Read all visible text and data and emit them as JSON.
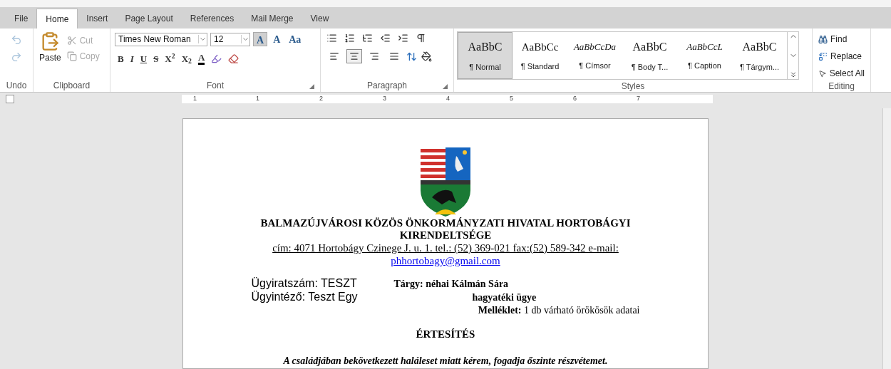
{
  "tabs": [
    {
      "label": "File",
      "selected": false
    },
    {
      "label": "Home",
      "selected": true
    },
    {
      "label": "Insert",
      "selected": false
    },
    {
      "label": "Page Layout",
      "selected": false
    },
    {
      "label": "References",
      "selected": false
    },
    {
      "label": "Mail Merge",
      "selected": false
    },
    {
      "label": "View",
      "selected": false
    }
  ],
  "undo": {
    "label": "Undo"
  },
  "clipboard": {
    "paste": "Paste",
    "cut": "Cut",
    "copy": "Copy",
    "label": "Clipboard"
  },
  "font": {
    "name": "Times New Roman",
    "size": "12",
    "label": "Font",
    "size_buttons": [
      {
        "label": "A",
        "selected": true
      },
      {
        "label": "A",
        "selected": false
      },
      {
        "label": "Aa",
        "selected": false
      }
    ],
    "format_buttons": [
      {
        "kind": "bold",
        "label": "B"
      },
      {
        "kind": "italic",
        "label": "I"
      },
      {
        "kind": "underline",
        "label": "U"
      },
      {
        "kind": "strike",
        "label": "S"
      },
      {
        "kind": "super",
        "label": "X$^{2}$"
      },
      {
        "kind": "sub",
        "label": "X$_{2}$"
      },
      {
        "kind": "color",
        "label": "A"
      }
    ]
  },
  "paragraph": {
    "label": "Paragraph",
    "align": [
      {
        "selected": false
      },
      {
        "selected": true
      },
      {
        "selected": false
      },
      {
        "selected": false
      }
    ]
  },
  "styles": {
    "label": "Styles",
    "items": [
      {
        "preview": "AaBbC",
        "name": "¶ Normal",
        "kind": "serif",
        "selected": true
      },
      {
        "preview": "AaBbCc",
        "name": "¶ Standard",
        "kind": "sans",
        "selected": false
      },
      {
        "preview": "AaBbCcDa",
        "name": "¶ Címsor",
        "kind": "italic",
        "selected": false
      },
      {
        "preview": "AaBbC",
        "name": "¶ Body T...",
        "kind": "serif",
        "selected": false
      },
      {
        "preview": "AaBbCcL",
        "name": "¶ Caption",
        "kind": "italic",
        "selected": false
      },
      {
        "preview": "AaBbC",
        "name": "¶ Tárgym...",
        "kind": "serif",
        "selected": false
      }
    ]
  },
  "editing": {
    "label": "Editing",
    "find": "Find",
    "replace": "Replace",
    "select_all": "Select All"
  },
  "ruler": {
    "numbers": [
      "1",
      "1",
      "2",
      "3",
      "4",
      "5",
      "6",
      "7"
    ]
  },
  "document": {
    "org_name": "BALMAZÚJVÁROSI KÖZÖS ÖNKORMÁNYZATI HIVATAL HORTOBÁGYI KIRENDELTSÉGE",
    "address": "cím: 4071 Hortobágy Czinege J. u. 1. tel.: (52) 369-021 fax:(52) 589-342 e-mail:",
    "email": "phhortobagy@gmail.com",
    "file_number": "Ügyiratszám: TESZT",
    "clerk": "Ügyintéző: Teszt Egy",
    "subject": "Tárgy: néhai Kálmán Sára",
    "subject_cont": "hagyatéki ügye",
    "attachment": "**Melléklet:** 1 db várható örökösök adatai",
    "title": "ÉRTESÍTÉS",
    "sentence": "A családjában bekövetkezett haláleset miatt kérem, fogadja őszinte részvétemet."
  }
}
